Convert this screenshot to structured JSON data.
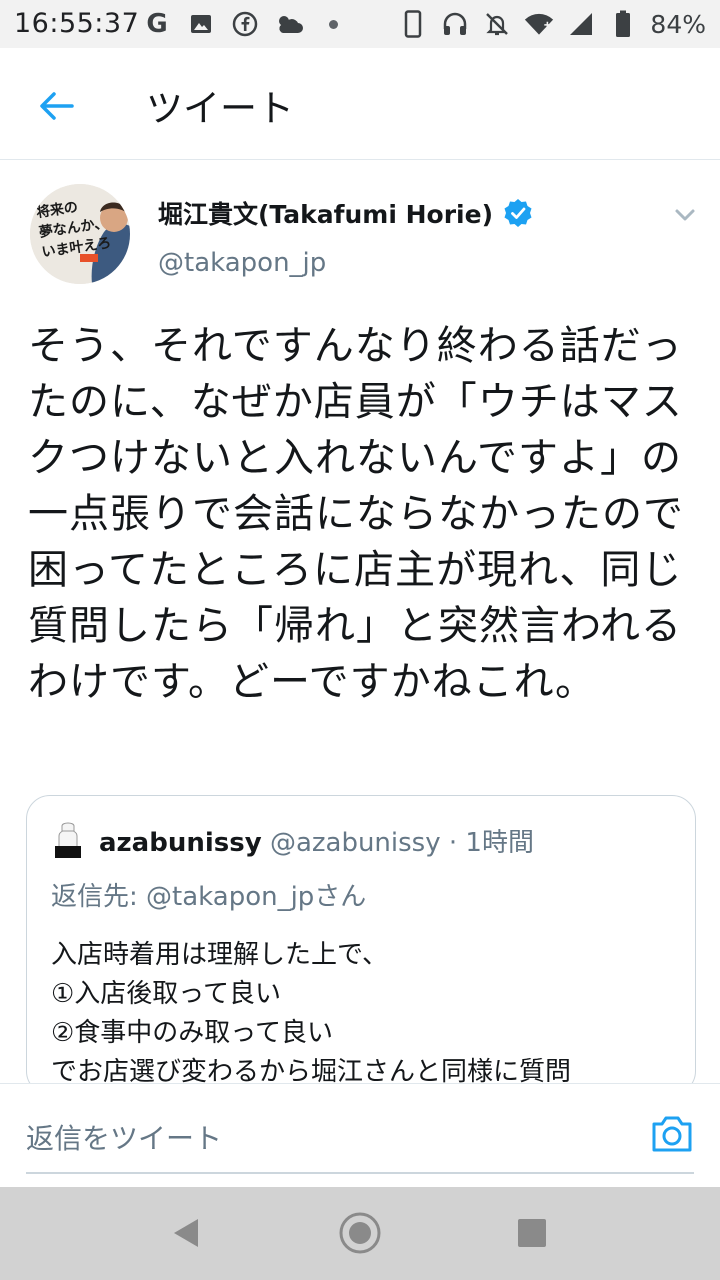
{
  "status_bar": {
    "time": "16:55:37",
    "left_icons": [
      "google-icon",
      "image-icon",
      "facebook-icon",
      "weather-icon",
      "dot-icon"
    ],
    "right_icons": [
      "phone-icon",
      "headset-icon",
      "mute-icon",
      "wifi-icon",
      "signal-icon",
      "battery-icon"
    ],
    "battery_percent": "84%",
    "g_letter": "G"
  },
  "header": {
    "title": "ツイート"
  },
  "tweet": {
    "author_name": "堀江貴文(Takafumi Horie)",
    "author_handle": "@takapon_jp",
    "verified": true,
    "text": "そう、それですんなり終わる話だったのに、なぜか店員が「ウチはマスクつけないと入れないんですよ」の一点張りで会話にならなかったので困ってたところに店主が現れ、同じ質問したら「帰れ」と突然言われるわけです。どーですかねこれ。",
    "avatar_book_text": "将来の夢なんか、いま叶えろ"
  },
  "quoted_tweet": {
    "name": "azabunissy",
    "handle": "@azabunissy",
    "time": "· 1時間",
    "reply_prefix": "返信先: ",
    "reply_handle": "@takapon_jpさん",
    "lines": [
      "入店時着用は理解した上で、",
      "①入店後取って良い",
      "②食事中のみ取って良い",
      "でお店選び変わるから堀江さんと同様に質問"
    ]
  },
  "reply_bar": {
    "placeholder": "返信をツイート"
  },
  "colors": {
    "accent": "#1da1f2",
    "text_primary": "#14171a",
    "text_secondary": "#657786",
    "status_bar_bg": "#f2f2f2",
    "nav_bar_bg": "#d2d2d2"
  }
}
